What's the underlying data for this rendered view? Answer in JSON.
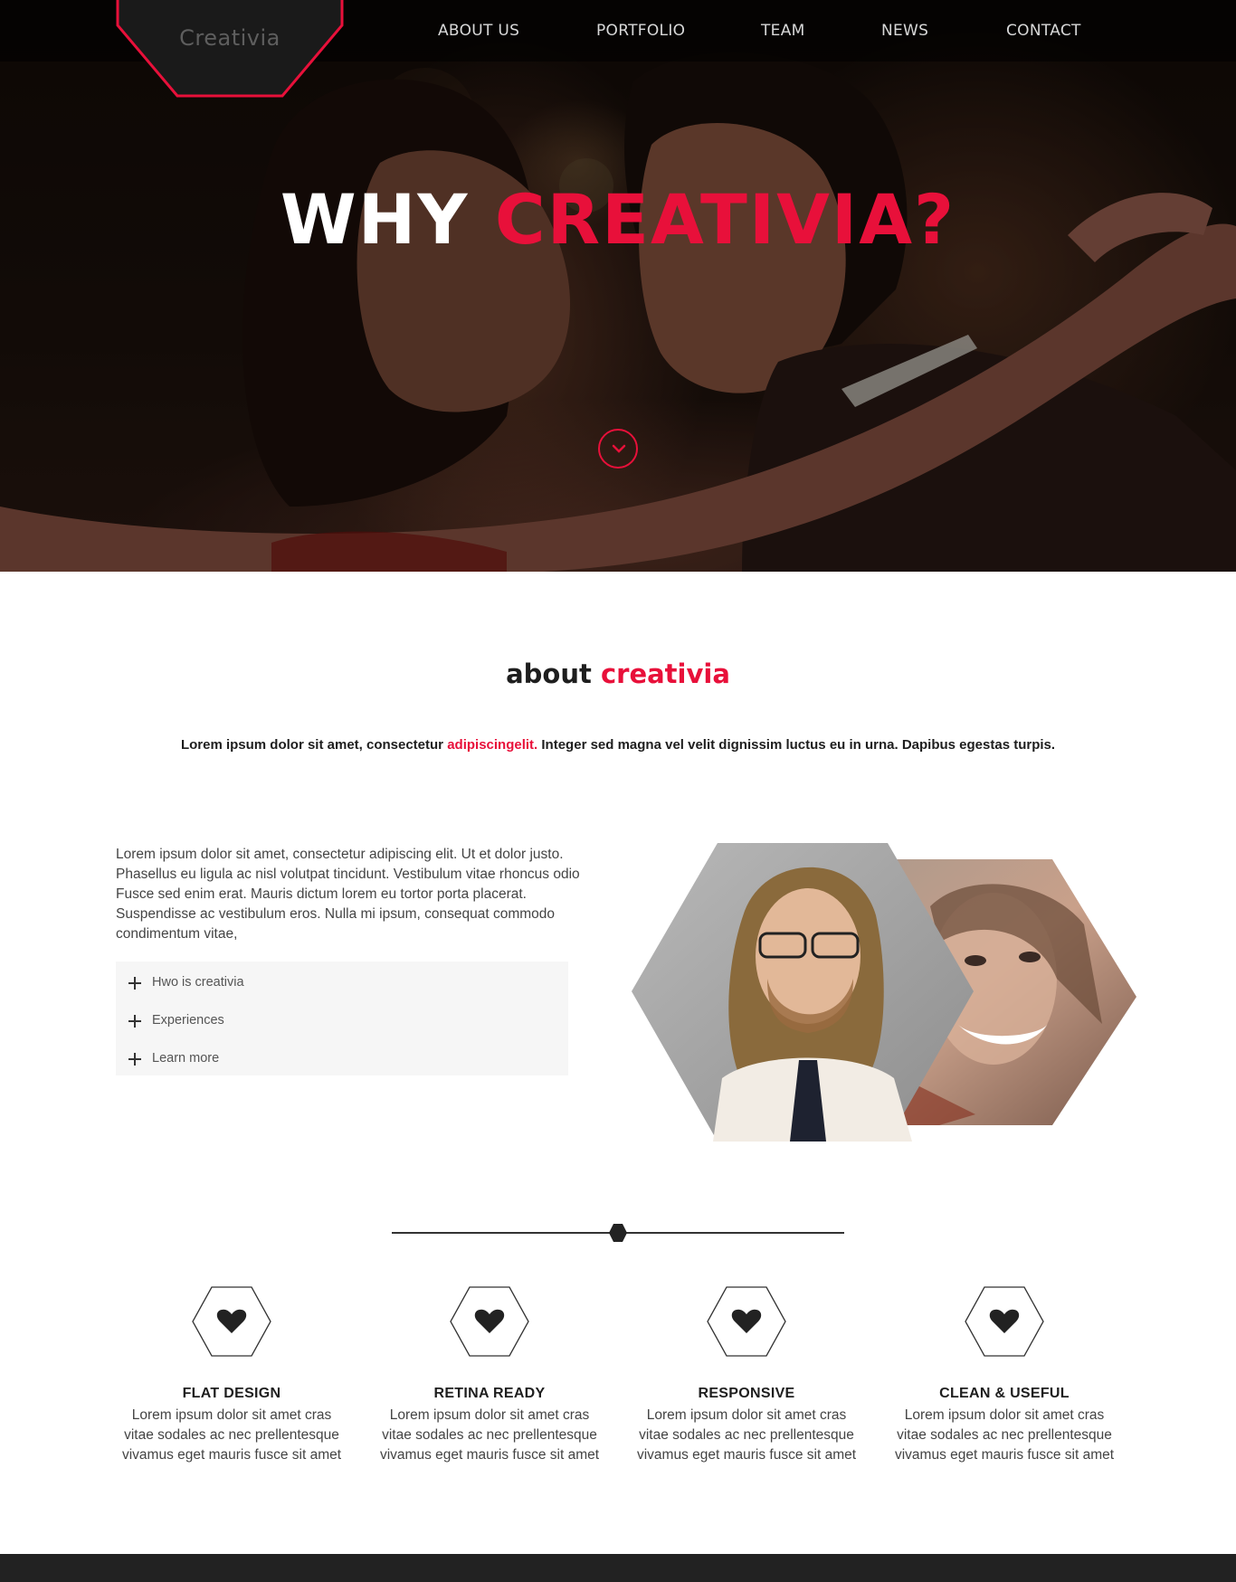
{
  "brand": {
    "logo_text": "Creativia",
    "accent_color": "#e8103a"
  },
  "nav": {
    "items": [
      "ABOUT US",
      "PORTFOLIO",
      "TEAM",
      "NEWS",
      "CONTACT"
    ]
  },
  "hero": {
    "title_white": "WHY",
    "title_accent": "CREATIVIA?"
  },
  "about": {
    "title_dark": "about",
    "title_accent": "creativia",
    "lead_before": "Lorem ipsum dolor sit amet, consectetur",
    "lead_accent": "adipiscingelit.",
    "lead_after": "Integer sed magna vel velit dignissim luctus eu in urna. Dapibus egestas turpis.",
    "body": "Lorem ipsum dolor sit amet, consectetur adipiscing elit. Ut et dolor justo. Phasellus eu ligula ac nisl volutpat tincidunt. Vestibulum vitae rhoncus odio Fusce sed enim erat. Mauris dictum lorem eu tortor porta placerat. Suspendisse ac vestibulum eros. Nulla mi ipsum, consequat commodo condimentum vitae,",
    "accordion": [
      "Hwo is creativia",
      "Experiences",
      "Learn more"
    ]
  },
  "features": [
    {
      "icon": "heart-icon",
      "title": "FLAT DESIGN",
      "text": "Lorem ipsum dolor sit amet cras vitae sodales ac nec prellentesque vivamus eget mauris fusce sit amet"
    },
    {
      "icon": "heart-icon",
      "title": "RETINA READY",
      "text": "Lorem ipsum dolor sit amet cras vitae sodales ac nec prellentesque vivamus eget mauris fusce sit amet"
    },
    {
      "icon": "heart-icon",
      "title": "RESPONSIVE",
      "text": "Lorem ipsum dolor sit amet cras vitae sodales ac nec prellentesque vivamus eget mauris fusce sit amet"
    },
    {
      "icon": "heart-icon",
      "title": "CLEAN & USEFUL",
      "text": "Lorem ipsum dolor sit amet cras vitae sodales ac nec prellentesque vivamus eget mauris fusce sit amet"
    }
  ]
}
